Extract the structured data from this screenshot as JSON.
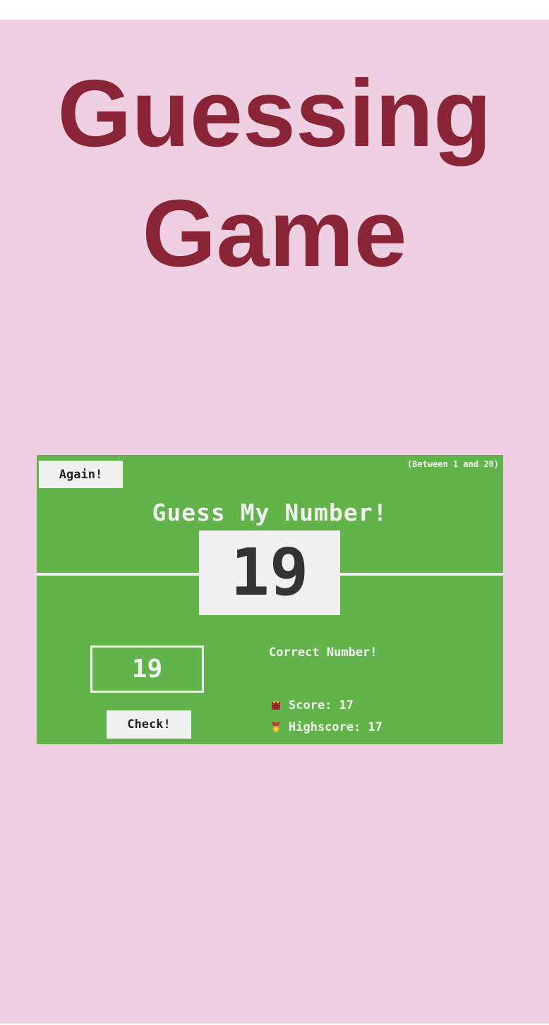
{
  "page": {
    "title": "Guessing Game"
  },
  "game": {
    "again_label": "Again!",
    "range_hint": "(Between 1 and 20)",
    "heading": "Guess My Number!",
    "secret_number": "19",
    "guess_value": "19",
    "check_label": "Check!",
    "message": "Correct Number!",
    "score_label": "Score:",
    "score_value": "17",
    "highscore_label": "Highscore:",
    "highscore_value": "17",
    "score_icon": "score-icon",
    "highscore_icon": "medal-icon"
  },
  "colors": {
    "page_bg": "#efd0e2",
    "title": "#8a2538",
    "game_bg": "#62b349",
    "panel": "#f0f0f0",
    "number_text": "#333333"
  }
}
